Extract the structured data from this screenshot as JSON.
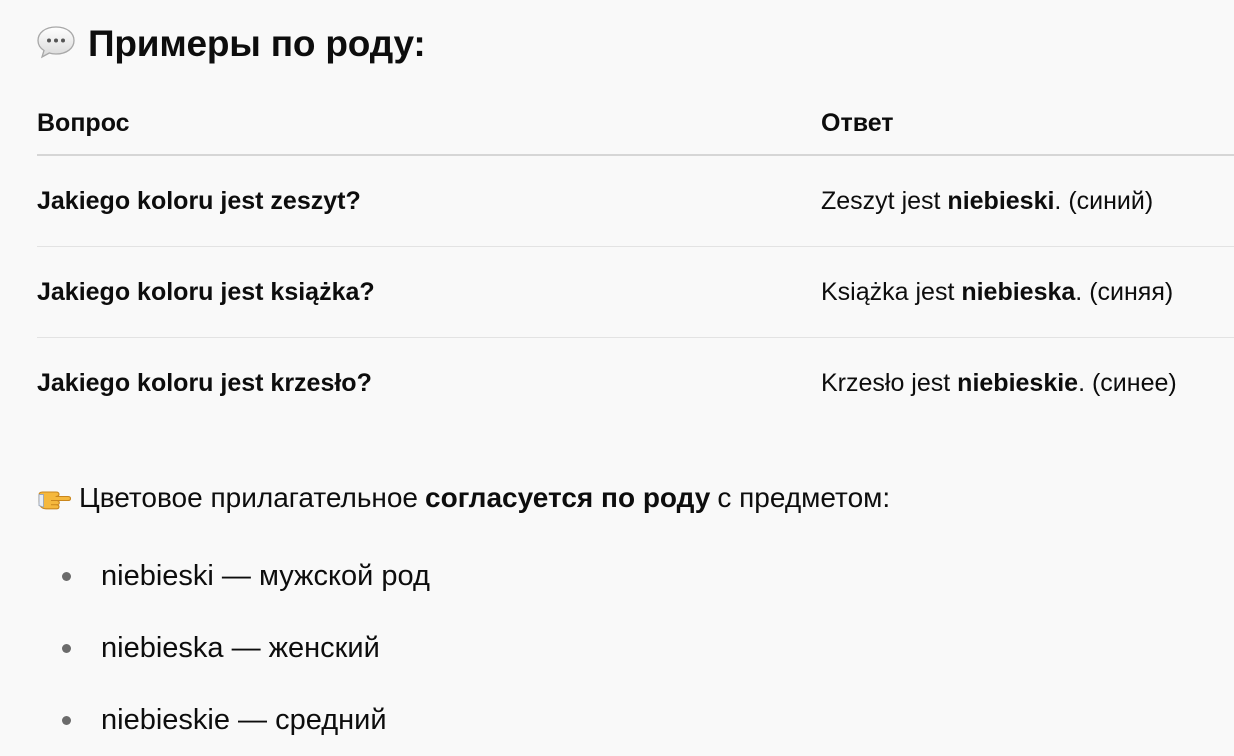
{
  "heading": {
    "icon": "speech-bubble-icon",
    "text": "Примеры по роду:"
  },
  "table": {
    "headers": [
      "Вопрос",
      "Ответ"
    ],
    "rows": [
      {
        "question": "Jakiego koloru jest zeszyt?",
        "answer_pre": "Zeszyt jest ",
        "answer_bold": "niebieski",
        "answer_post": ". (синий)"
      },
      {
        "question": "Jakiego koloru jest książka?",
        "answer_pre": "Książka jest ",
        "answer_bold": "niebieska",
        "answer_post": ". (синяя)"
      },
      {
        "question": "Jakiego koloru jest krzesło?",
        "answer_pre": "Krzesło jest ",
        "answer_bold": "niebieskie",
        "answer_post": ". (синее)"
      }
    ]
  },
  "note": {
    "icon": "pointing-hand-icon",
    "pre": "Цветовое прилагательное ",
    "bold": "согласуется по роду",
    "post": " с предметом:"
  },
  "list": [
    "niebieski — мужской род",
    "niebieska — женский",
    "niebieskie — средний"
  ],
  "colors": {
    "background": "#f9f9f9",
    "text": "#0d0d0d",
    "divider": "#e3e3e3",
    "bullet": "#6b6b6b"
  }
}
